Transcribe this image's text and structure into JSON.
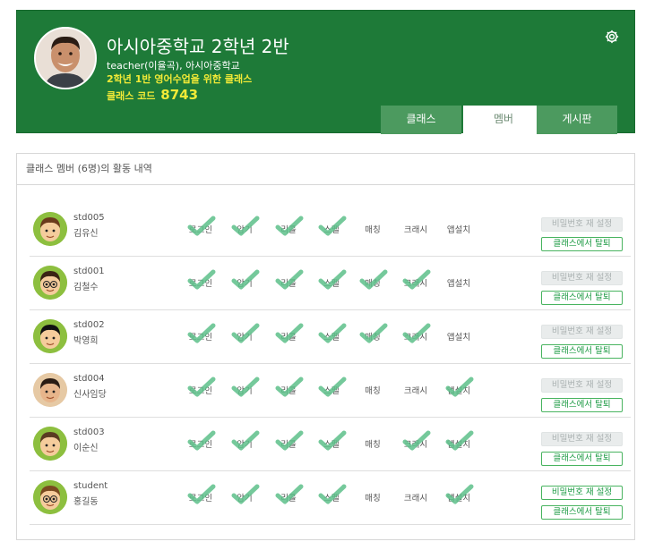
{
  "header": {
    "title": "아시아중학교 2학년 2반",
    "subtitle": "teacher(이율곡), 아시아중학교",
    "description": "2학년 1반 영어수업을 위한 클래스",
    "code_label": "클래스 코드",
    "code_value": "8743",
    "gear_icon": "gear-icon"
  },
  "tabs": [
    {
      "label": "클래스",
      "active": false
    },
    {
      "label": "멤버",
      "active": true
    },
    {
      "label": "게시판",
      "active": false
    }
  ],
  "panel": {
    "title": "클래스 멤버 (6명)의 활동 내역"
  },
  "activity_labels": [
    "로그인",
    "암기",
    "리콜",
    "스펠",
    "매칭",
    "크래시",
    "앱설치"
  ],
  "buttons": {
    "reset_password": "비밀번호 재 설정",
    "leave_class": "클래스에서 탈퇴"
  },
  "colors": {
    "brand": "#1e7a38",
    "check": "#5dc08a",
    "accent_text": "#f2ea37",
    "button_green": "#1e9b45"
  },
  "members": [
    {
      "id": "std005",
      "name": "김유신",
      "avatar": "boy-avatar",
      "done": [
        true,
        true,
        true,
        true,
        false,
        false,
        false
      ],
      "password_reset_enabled": false
    },
    {
      "id": "std001",
      "name": "김철수",
      "avatar": "boy-glasses-avatar",
      "done": [
        true,
        true,
        true,
        true,
        true,
        true,
        false
      ],
      "password_reset_enabled": false
    },
    {
      "id": "std002",
      "name": "박영희",
      "avatar": "girl-avatar",
      "done": [
        true,
        true,
        true,
        true,
        true,
        true,
        false
      ],
      "password_reset_enabled": false
    },
    {
      "id": "std004",
      "name": "신사임당",
      "avatar": "woman-avatar",
      "done": [
        true,
        true,
        true,
        true,
        false,
        false,
        true
      ],
      "password_reset_enabled": false
    },
    {
      "id": "std003",
      "name": "이순신",
      "avatar": "man-avatar",
      "done": [
        true,
        true,
        true,
        true,
        false,
        true,
        true
      ],
      "password_reset_enabled": false
    },
    {
      "id": "student",
      "name": "홍길동",
      "avatar": "student-avatar",
      "done": [
        true,
        true,
        true,
        true,
        false,
        false,
        true
      ],
      "password_reset_enabled": true
    }
  ]
}
